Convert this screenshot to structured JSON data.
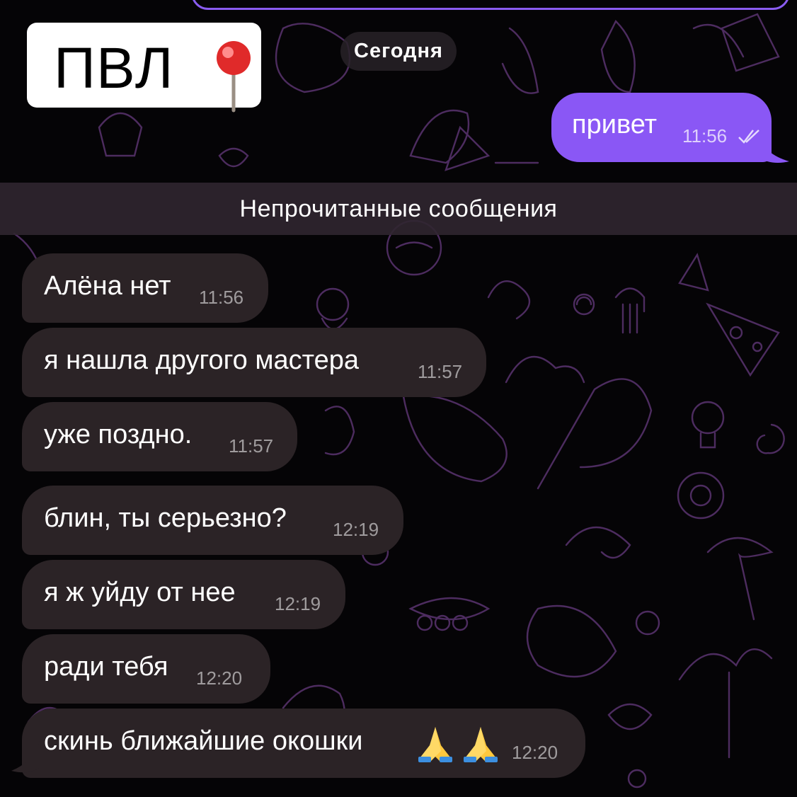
{
  "overlay_label": {
    "text": "ПВЛ",
    "pin_icon": "round-pushpin-icon"
  },
  "date_separator": "Сегодня",
  "outgoing": {
    "text": "привет",
    "time": "11:56",
    "status_icon": "double-check-read-icon"
  },
  "unread_separator": "Непрочитанные сообщения",
  "incoming": [
    {
      "text": "Алёна нет",
      "time": "11:56"
    },
    {
      "text": "я нашла другого мастера",
      "time": "11:57"
    },
    {
      "text": "уже поздно.",
      "time": "11:57"
    },
    {
      "text": "блин, ты серьезно?",
      "time": "12:19"
    },
    {
      "text": "я ж уйду от нее",
      "time": "12:19"
    },
    {
      "text": "ради тебя",
      "time": "12:20"
    },
    {
      "text": "скинь ближайшие окошки",
      "time": "12:20",
      "emoji_icon": "folded-hands-icon"
    }
  ],
  "colors": {
    "background": "#050406",
    "outgoing_bubble": "#8a57f5",
    "incoming_bubble": "#2b2326",
    "doodle_stroke": "#6b3f86"
  }
}
